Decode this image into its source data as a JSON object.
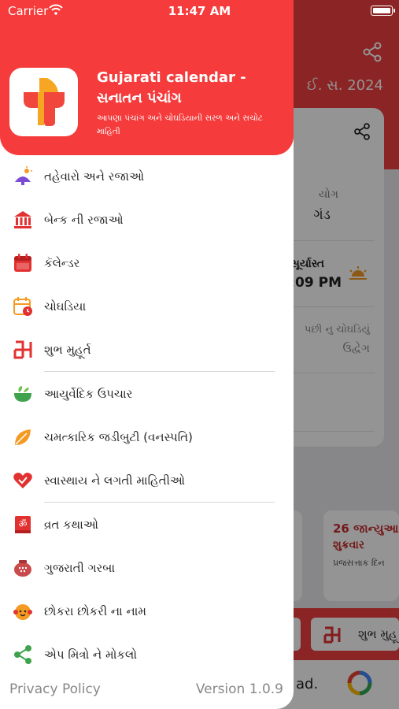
{
  "status_bar": {
    "carrier": "Carrier",
    "time": "11:47 AM"
  },
  "background": {
    "year": "ઈ. સ. 2024",
    "yog_label": "યોગ",
    "yog_value": "ગંડ",
    "sunset_label": "સૂર્યાસ્ત",
    "sunset_time": ":09 PM",
    "next_choghadiya_label": "પછી નુ ચોઘડિયું",
    "next_choghadiya_value": "ઉદ્વેગ",
    "holiday_date": "26 જાન્યુઆ",
    "holiday_day": "શુક્રવાર",
    "holiday_name": "પ્રજસત્તાક દિન",
    "bottom_button": "શુભ મુહૂ",
    "ad_text": "ad."
  },
  "drawer": {
    "title": "Gujarati calendar - સનાતન પંચાંગ",
    "subtitle": "આપણા પંચાંગ અને ચોઘડિયાની સરળ અને સચોટ માહિતી",
    "items": [
      {
        "label": "તહેવારો અને રજાઓ",
        "icon": "festival-icon"
      },
      {
        "label": "બેન્ક ની રજાઓ",
        "icon": "bank-icon"
      },
      {
        "label": "કૅલેન્ડર",
        "icon": "calendar-icon"
      },
      {
        "label": "ચોઘડિયા",
        "icon": "choghadiya-icon"
      },
      {
        "label": "શુભ મુહૂર્ત",
        "icon": "swastik-icon"
      },
      {
        "label": "આયુર્વેદિક ઉપચાર",
        "icon": "mortar-icon"
      },
      {
        "label": "ચમત્કારિક જડીબુટી (વનસ્પતિ)",
        "icon": "leaf-icon"
      },
      {
        "label": "સ્વાસ્થાય ને લગતી માહિતીઓ",
        "icon": "heart-icon"
      },
      {
        "label": "વ્રત કથાઓ",
        "icon": "om-book-icon"
      },
      {
        "label": "ગુજરાતી ગરબા",
        "icon": "garba-icon"
      },
      {
        "label": "છોકરા છોકરી ના નામ",
        "icon": "baby-icon"
      },
      {
        "label": "એપ મિત્રો ને મોકલો",
        "icon": "share-icon"
      }
    ],
    "privacy_policy": "Privacy Policy",
    "version": "Version 1.0.9"
  },
  "colors": {
    "brand_red": "#f53b3b",
    "text": "#222222",
    "muted": "#888888"
  }
}
